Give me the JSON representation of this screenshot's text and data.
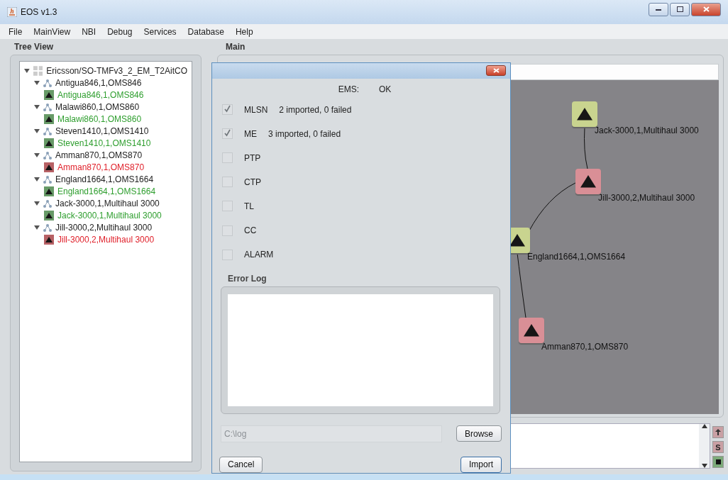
{
  "window": {
    "title": "EOS v1.3"
  },
  "menu": [
    "File",
    "MainView",
    "NBI",
    "Debug",
    "Services",
    "Database",
    "Help"
  ],
  "tree_view": {
    "title": "Tree View",
    "root": {
      "label": "Ericsson/SO-TMFv3_2_EM_T2AitCO",
      "expanded": true,
      "children": [
        {
          "label": "Antigua846,1,OMS846",
          "expanded": true,
          "children": [
            {
              "label": "Antigua846,1,OMS846",
              "color": "#2e9e2e"
            }
          ]
        },
        {
          "label": "Malawi860,1,OMS860",
          "expanded": true,
          "children": [
            {
              "label": "Malawi860,1,OMS860",
              "color": "#2e9e2e"
            }
          ]
        },
        {
          "label": "Steven1410,1,OMS1410",
          "expanded": true,
          "children": [
            {
              "label": "Steven1410,1,OMS1410",
              "color": "#2e9e2e"
            }
          ]
        },
        {
          "label": "Amman870,1,OMS870",
          "expanded": true,
          "children": [
            {
              "label": "Amman870,1,OMS870",
              "color": "#e0202a"
            }
          ]
        },
        {
          "label": "England1664,1,OMS1664",
          "expanded": true,
          "children": [
            {
              "label": "England1664,1,OMS1664",
              "color": "#2e9e2e"
            }
          ]
        },
        {
          "label": "Jack-3000,1,Multihaul 3000",
          "expanded": true,
          "children": [
            {
              "label": "Jack-3000,1,Multihaul 3000",
              "color": "#2e9e2e"
            }
          ]
        },
        {
          "label": "Jill-3000,2,Multihaul 3000",
          "expanded": true,
          "children": [
            {
              "label": "Jill-3000,2,Multihaul 3000",
              "color": "#e0202a"
            }
          ]
        }
      ]
    }
  },
  "main": {
    "title": "Main",
    "graph": {
      "nodes": [
        {
          "label": "Jack-3000,1,Multihaul 3000",
          "color": "#c9d48f"
        },
        {
          "label": "Jill-3000,2,Multihaul 3000",
          "color": "#d98f96"
        },
        {
          "label": "England1664,1,OMS1664",
          "color": "#c9d48f"
        },
        {
          "label": "Amman870,1,OMS870",
          "color": "#d98f96"
        }
      ]
    },
    "console_buttons": [
      {
        "kind": "up"
      },
      {
        "kind": "text",
        "label": "S"
      },
      {
        "kind": "stop"
      }
    ]
  },
  "dialog": {
    "ems_label": "EMS:",
    "ems_value": "OK",
    "items": [
      {
        "label": "MLSN",
        "result": "2 imported, 0 failed",
        "checked": true
      },
      {
        "label": "ME",
        "result": "3 imported, 0 failed",
        "checked": true
      },
      {
        "label": "PTP",
        "checked": false
      },
      {
        "label": "CTP",
        "checked": false
      },
      {
        "label": "TL",
        "checked": false
      },
      {
        "label": "CC",
        "checked": false
      },
      {
        "label": "ALARM",
        "checked": false
      }
    ],
    "error_log": {
      "title": "Error Log"
    },
    "path": {
      "value": "C:\\log",
      "disabled": true
    },
    "browse": "Browse",
    "cancel": "Cancel",
    "import": "Import"
  }
}
